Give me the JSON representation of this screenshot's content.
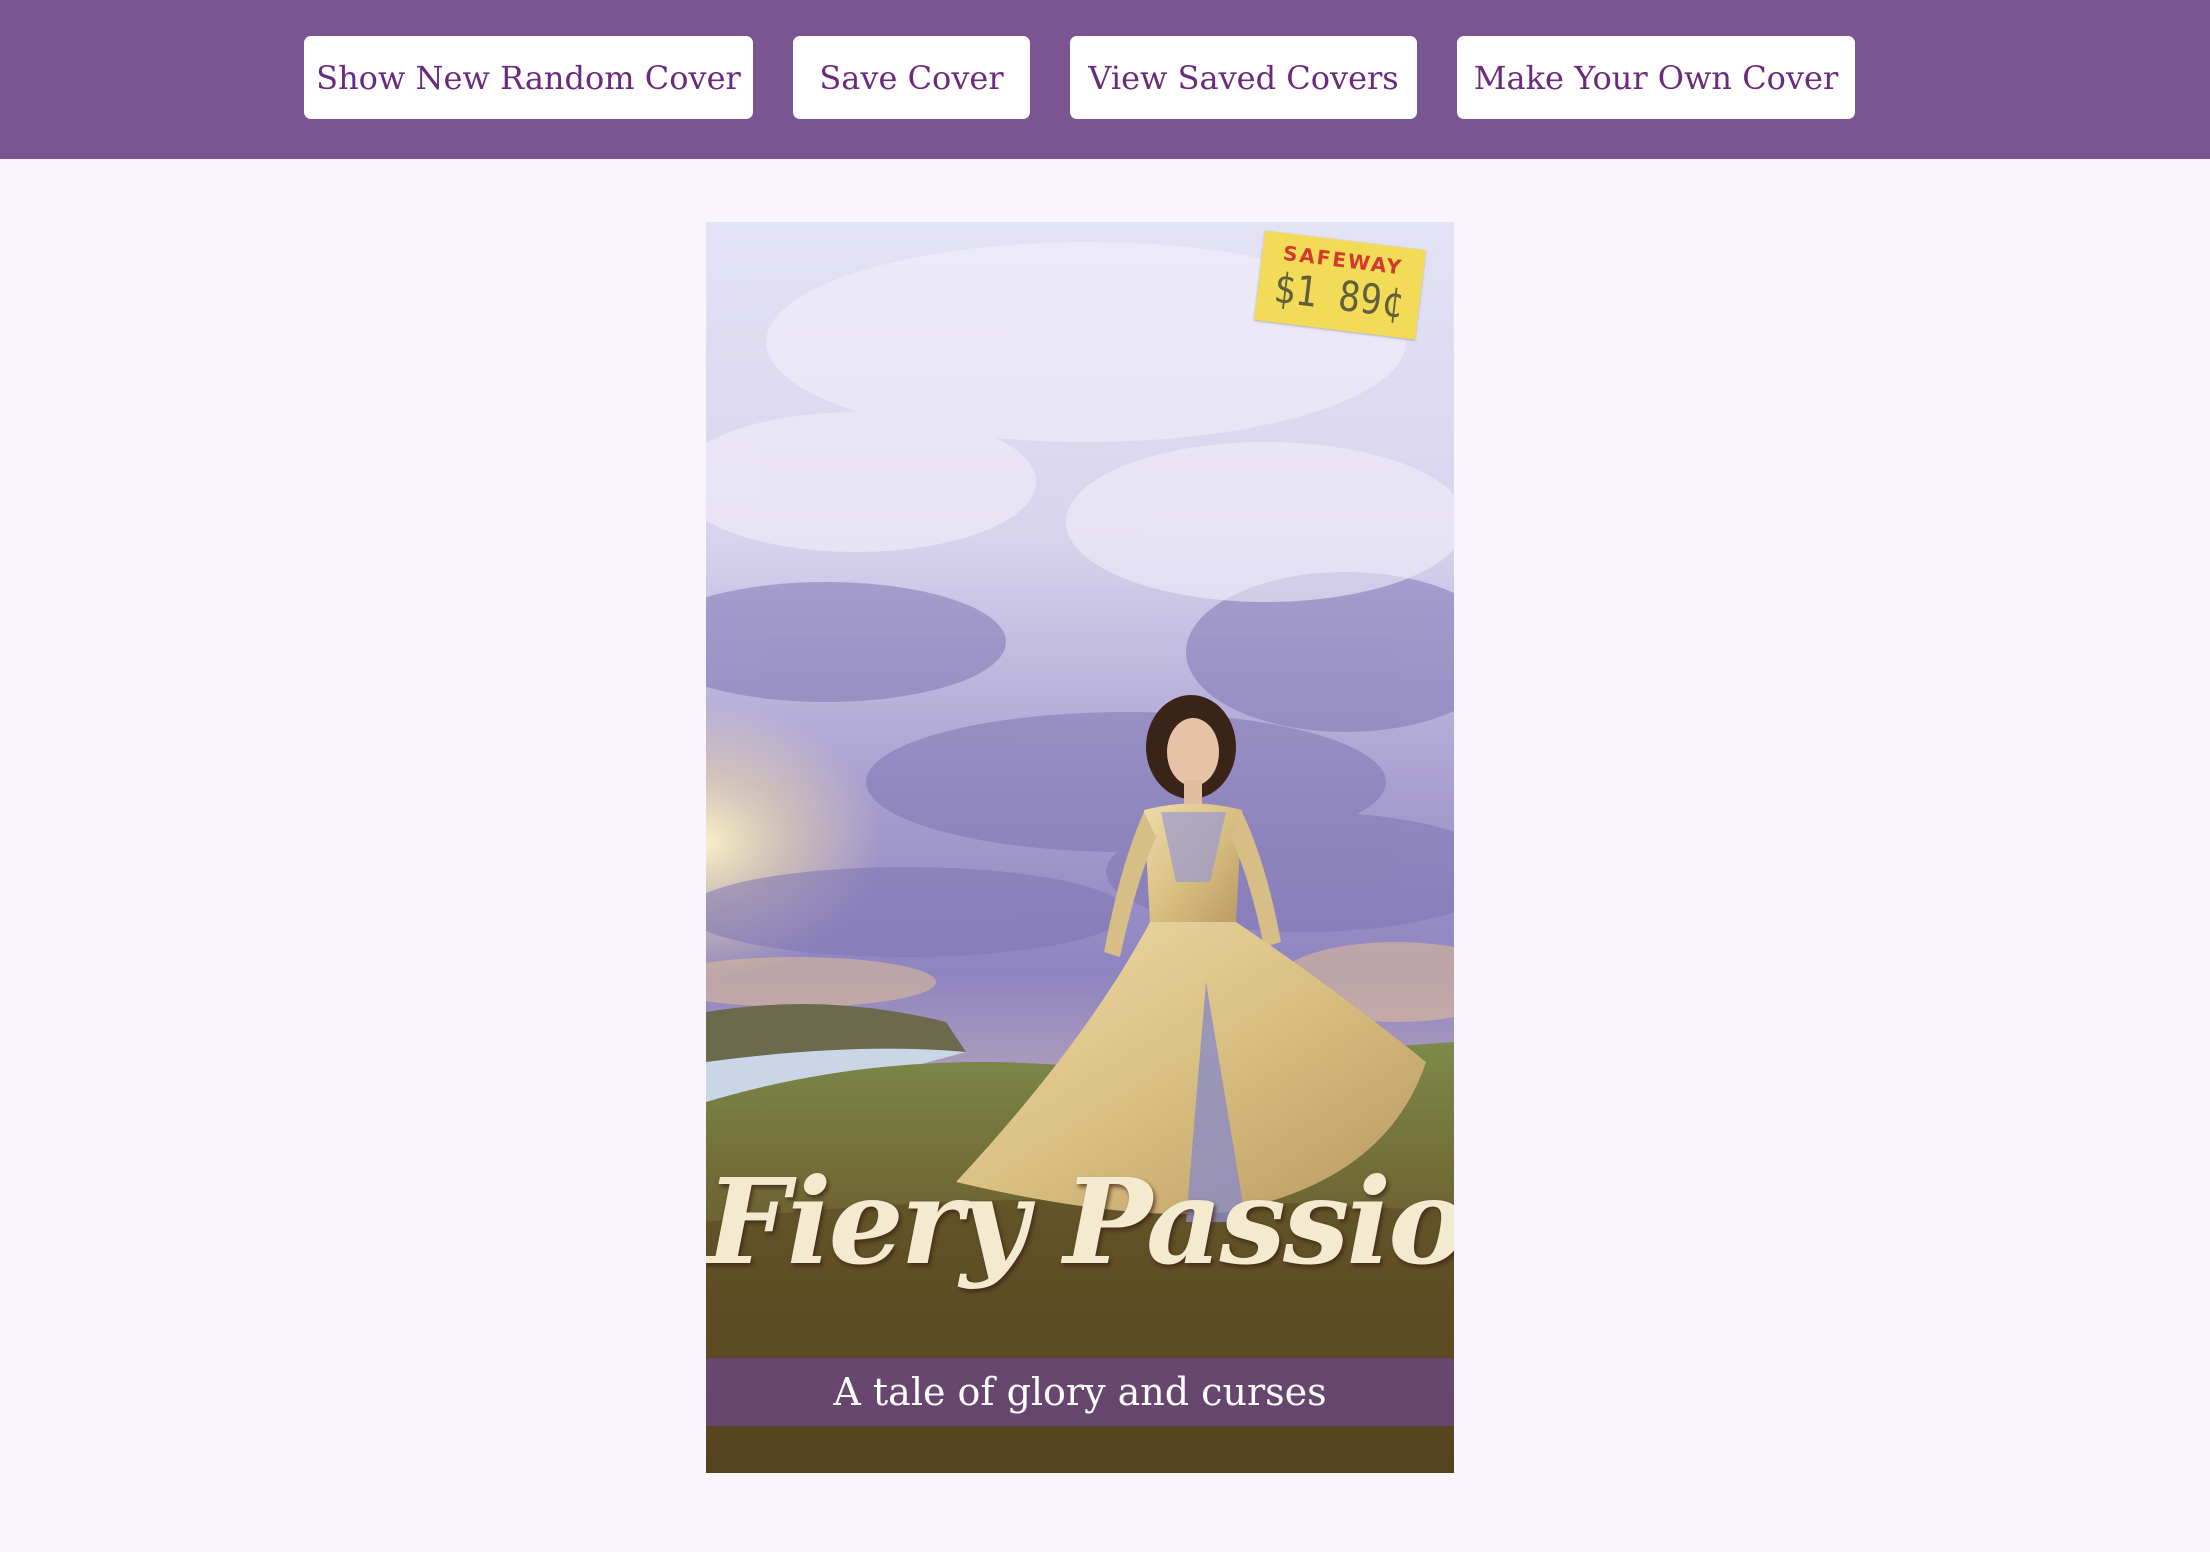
{
  "nav": {
    "random_label": "Show New Random Cover",
    "save_label": "Save Cover",
    "view_saved_label": "View Saved Covers",
    "make_own_label": "Make Your Own Cover"
  },
  "cover": {
    "title": "Fiery Passion",
    "tagline": "A tale of glory and curses",
    "price_tag": {
      "store": "SAFEWAY",
      "price": "$1 89¢"
    }
  },
  "colors": {
    "header": "#7a5592",
    "button_text": "#6b2a7d",
    "page_background": "#f8f6fc"
  }
}
